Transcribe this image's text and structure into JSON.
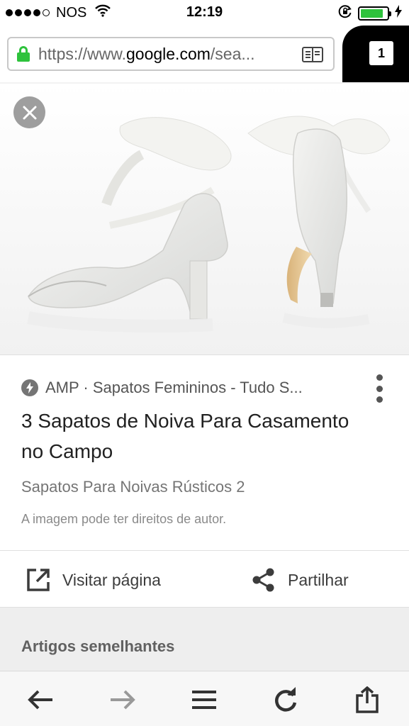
{
  "status_bar": {
    "carrier": "NOS",
    "time": "12:19",
    "battery_level": 0.85,
    "signal_bars": 4
  },
  "browser": {
    "url_prefix": "https://www.",
    "url_domain": "google.com",
    "url_suffix": "/sea...",
    "tab_count": "1"
  },
  "result": {
    "source": "AMP · Sapatos Femininos - Tudo S...",
    "title": "3 Sapatos de Noiva Para Casamento no Campo",
    "subtitle": "Sapatos Para Noivas Rústicos 2",
    "copyright_note": "A imagem pode ter direitos de autor."
  },
  "actions": {
    "visit_label": "Visitar página",
    "share_label": "Partilhar"
  },
  "similar": {
    "heading": "Artigos semelhantes"
  },
  "icons": {
    "close": "close-icon",
    "amp": "amp-bolt-icon",
    "more": "more-vertical-icon",
    "visit": "open-external-icon",
    "share": "share-icon",
    "back": "back-arrow-icon",
    "forward": "forward-arrow-icon",
    "menu": "menu-icon",
    "reload": "reload-icon",
    "share_toolbar": "share-up-icon"
  },
  "colors": {
    "secure_lock": "#2ec23c",
    "battery": "#2ec23c",
    "tab_counter_bg": "#000000"
  }
}
